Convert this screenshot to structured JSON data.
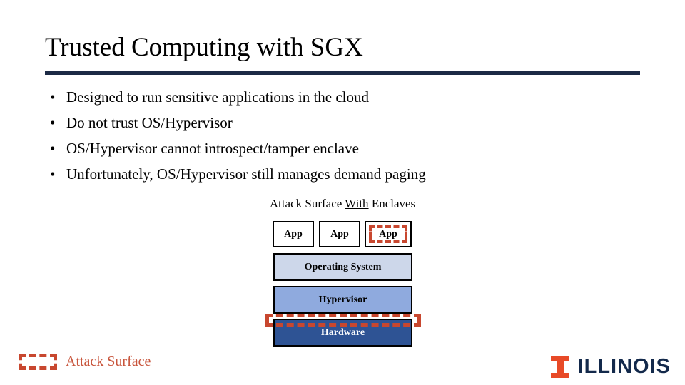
{
  "slide": {
    "title": "Trusted Computing with SGX",
    "bullet_marker": "•",
    "bullets": [
      "Designed to run sensitive applications in the cloud",
      "Do not trust OS/Hypervisor",
      "OS/Hypervisor cannot introspect/tamper enclave",
      "Unfortunately, OS/Hypervisor still manages demand paging"
    ]
  },
  "diagram": {
    "caption_prefix": "Attack Surface ",
    "caption_emphasis": "With",
    "caption_suffix": " Enclaves",
    "apps": [
      {
        "label": "App",
        "enclave": false
      },
      {
        "label": "App",
        "enclave": false
      },
      {
        "label": "App",
        "enclave": true
      }
    ],
    "stack": [
      {
        "label": "Operating System",
        "fill": "#cdd7ea",
        "text_color": "#000000"
      },
      {
        "label": "Hypervisor",
        "fill": "#8faade",
        "text_color": "#000000"
      },
      {
        "label": "Hardware",
        "fill": "#2e5394",
        "text_color": "#ffffff"
      }
    ]
  },
  "legend": {
    "label": "Attack Surface",
    "color": "#c8472f"
  },
  "logo": {
    "wordmark": "ILLINOIS",
    "block_i_color": "#e84a27",
    "wordmark_color": "#13294b"
  },
  "colors": {
    "title_rule": "#1c2a45",
    "attack_surface": "#c8472f"
  }
}
